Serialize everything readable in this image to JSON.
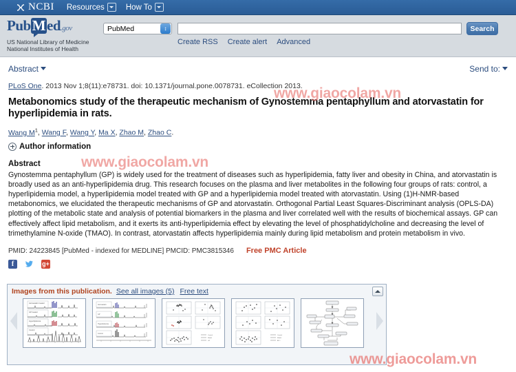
{
  "ncbi_bar": {
    "logo_text": "NCBI",
    "menu": [
      {
        "label": "Resources",
        "icon": "chevron-down-icon"
      },
      {
        "label": "How To",
        "icon": "chevron-down-icon"
      }
    ]
  },
  "brand": {
    "word_pub": "Pub",
    "word_med": "M",
    "word_ed": "ed",
    "word_gov": ".gov",
    "tagline_line1": "US National Library of Medicine",
    "tagline_line2": "National Institutes of Health"
  },
  "search": {
    "database_value": "PubMed",
    "query_value": "",
    "query_placeholder": "",
    "button_label": "Search",
    "links": [
      "Create RSS",
      "Create alert",
      "Advanced"
    ]
  },
  "toolbar": {
    "display_format": "Abstract",
    "send_to": "Send to:"
  },
  "citation": {
    "journal": "PLoS One",
    "rest": ". 2013 Nov 1;8(11):e78731. doi: 10.1371/journal.pone.0078731. eCollection 2013."
  },
  "article": {
    "title": "Metabonomics study of the therapeutic mechanism of Gynostemma pentaphyllum and atorvastatin for hyperlipidemia in rats.",
    "authors": [
      {
        "name": "Wang M",
        "sup": "1"
      },
      {
        "name": "Wang F",
        "sup": ""
      },
      {
        "name": "Wang Y",
        "sup": ""
      },
      {
        "name": "Ma X",
        "sup": ""
      },
      {
        "name": "Zhao M",
        "sup": ""
      },
      {
        "name": "Zhao C",
        "sup": ""
      }
    ],
    "author_information": "Author information",
    "abstract_heading": "Abstract",
    "abstract_text": "Gynostemma pentaphyllum (GP) is widely used for the treatment of diseases such as hyperlipidemia, fatty liver and obesity in China, and atorvastatin is broadly used as an anti-hyperlipidemia drug. This research focuses on the plasma and liver metabolites in the following four groups of rats: control, a hyperlipidemia model, a hyperlipidemia model treated with GP and a hyperlipidemia model treated with atorvastatin. Using (1)H-NMR-based metabonomics, we elucidated the therapeutic mechanisms of GP and atorvastatin. Orthogonal Partial Least Squares-Discriminant analysis (OPLS-DA) plotting of the metabolic state and analysis of potential biomarkers in the plasma and liver correlated well with the results of biochemical assays. GP can effectively affect lipid metabolism, and it exerts its anti-hyperlipidemia effect by elevating the level of phosphatidylcholine and decreasing the level of trimethylamine N-oxide (TMAO). In contrast, atorvastatin affects hyperlipidemia mainly during lipid metabolism and protein metabolism in vivo.",
    "pmid_text": "PMID: 24223845 [PubMed - indexed for MEDLINE]  PMCID: PMC3815346",
    "free_pmc": "Free PMC Article"
  },
  "social": [
    {
      "name": "facebook-icon",
      "glyph": "f"
    },
    {
      "name": "twitter-icon",
      "glyph": "✈"
    },
    {
      "name": "googleplus-icon",
      "glyph": "g+"
    }
  ],
  "images_panel": {
    "title": "Images from this publication.",
    "see_all": "See all images (5)",
    "free_text": "Free text",
    "thumbnails": [
      {
        "name": "thumbnail-nmr-spectra-stacked",
        "kind": "spectra4"
      },
      {
        "name": "thumbnail-nmr-spectra-small",
        "kind": "spectra4"
      },
      {
        "name": "thumbnail-scatter-panels",
        "kind": "scatter"
      },
      {
        "name": "thumbnail-scatter-panels-2",
        "kind": "scatter"
      },
      {
        "name": "thumbnail-pathway-diagram",
        "kind": "pathway"
      }
    ],
    "collapse_icon": "collapse-icon",
    "prev_icon": "prev-arrow-icon",
    "next_icon": "next-arrow-icon"
  },
  "watermarks": {
    "w1": "www.giaocolam.vn",
    "w2": "www.giaocolam.vn",
    "w3": "www.giaocolam.vn"
  },
  "colors": {
    "header_blue": "#2d64a0",
    "band_grey": "#d6dbe0",
    "link_blue": "#2b4c7e",
    "free_pmc_red": "#c0432b",
    "panel_title_orange": "#b0441f",
    "watermark_red": "#e8726e"
  }
}
